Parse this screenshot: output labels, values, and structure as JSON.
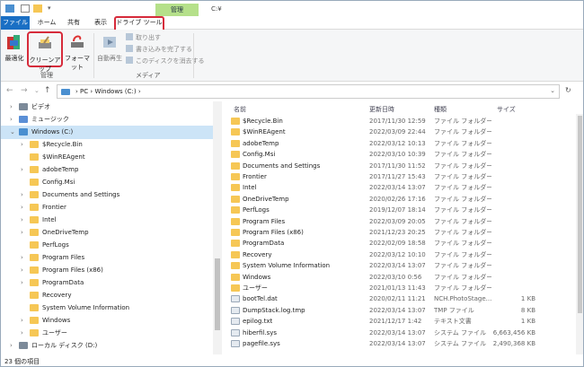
{
  "titlebar": {
    "context_tab": "管理",
    "path_title": "C:¥"
  },
  "ribbon_tabs": {
    "file": "ファイル",
    "home": "ホーム",
    "share": "共有",
    "view": "表示",
    "drive_tools": "ドライブ ツール"
  },
  "ribbon": {
    "optimize": "最適化",
    "cleanup": "クリーンアップ",
    "format": "フォーマット",
    "group_manage": "管理",
    "autoplay": "自動再生",
    "eject": "取り出す",
    "finish_burn": "書き込みを完了する",
    "erase_disc": "このディスクを消去する",
    "group_media": "メディア"
  },
  "nav": {
    "back": "←",
    "forward": "→",
    "recent": "⌄",
    "up": "↑",
    "crumb_sep": "›",
    "pc": "PC",
    "drive": "Windows (C:)",
    "dropdown": "⌄",
    "refresh": "↻"
  },
  "tree": [
    {
      "label": "ビデオ",
      "icon": "video",
      "indent": 0,
      "chev": "›"
    },
    {
      "label": "ミュージック",
      "icon": "music",
      "indent": 0,
      "chev": "›"
    },
    {
      "label": "Windows (C:)",
      "icon": "pc",
      "indent": 0,
      "chev": "⌄",
      "selected": true
    },
    {
      "label": "$Recycle.Bin",
      "icon": "folder",
      "indent": 1,
      "chev": "›"
    },
    {
      "label": "$WinREAgent",
      "icon": "folder",
      "indent": 1,
      "chev": ""
    },
    {
      "label": "adobeTemp",
      "icon": "folder",
      "indent": 1,
      "chev": "›"
    },
    {
      "label": "Config.Msi",
      "icon": "folder",
      "indent": 1,
      "chev": ""
    },
    {
      "label": "Documents and Settings",
      "icon": "folder",
      "indent": 1,
      "chev": "›"
    },
    {
      "label": "Frontier",
      "icon": "folder",
      "indent": 1,
      "chev": "›"
    },
    {
      "label": "Intel",
      "icon": "folder",
      "indent": 1,
      "chev": "›"
    },
    {
      "label": "OneDriveTemp",
      "icon": "folder",
      "indent": 1,
      "chev": "›"
    },
    {
      "label": "PerfLogs",
      "icon": "folder",
      "indent": 1,
      "chev": ""
    },
    {
      "label": "Program Files",
      "icon": "folder",
      "indent": 1,
      "chev": "›"
    },
    {
      "label": "Program Files (x86)",
      "icon": "folder",
      "indent": 1,
      "chev": "›"
    },
    {
      "label": "ProgramData",
      "icon": "folder",
      "indent": 1,
      "chev": "›"
    },
    {
      "label": "Recovery",
      "icon": "folder",
      "indent": 1,
      "chev": ""
    },
    {
      "label": "System Volume Information",
      "icon": "folder",
      "indent": 1,
      "chev": ""
    },
    {
      "label": "Windows",
      "icon": "folder",
      "indent": 1,
      "chev": "›"
    },
    {
      "label": "ユーザー",
      "icon": "folder",
      "indent": 1,
      "chev": "›"
    },
    {
      "label": "ローカル ディスク (D:)",
      "icon": "drive",
      "indent": 0,
      "chev": "›"
    }
  ],
  "list_headers": {
    "name": "名前",
    "date": "更新日時",
    "type": "種類",
    "size": "サイズ"
  },
  "files": [
    {
      "name": "$Recycle.Bin",
      "date": "2017/11/30 12:59",
      "type": "ファイル フォルダー",
      "size": "",
      "icon": "folder"
    },
    {
      "name": "$WinREAgent",
      "date": "2022/03/09 22:44",
      "type": "ファイル フォルダー",
      "size": "",
      "icon": "folder"
    },
    {
      "name": "adobeTemp",
      "date": "2022/03/12 10:13",
      "type": "ファイル フォルダー",
      "size": "",
      "icon": "folder"
    },
    {
      "name": "Config.Msi",
      "date": "2022/03/10 10:39",
      "type": "ファイル フォルダー",
      "size": "",
      "icon": "folder"
    },
    {
      "name": "Documents and Settings",
      "date": "2017/11/30 11:52",
      "type": "ファイル フォルダー",
      "size": "",
      "icon": "folder"
    },
    {
      "name": "Frontier",
      "date": "2017/11/27 15:43",
      "type": "ファイル フォルダー",
      "size": "",
      "icon": "folder"
    },
    {
      "name": "Intel",
      "date": "2022/03/14 13:07",
      "type": "ファイル フォルダー",
      "size": "",
      "icon": "folder"
    },
    {
      "name": "OneDriveTemp",
      "date": "2020/02/26 17:16",
      "type": "ファイル フォルダー",
      "size": "",
      "icon": "folder"
    },
    {
      "name": "PerfLogs",
      "date": "2019/12/07 18:14",
      "type": "ファイル フォルダー",
      "size": "",
      "icon": "folder"
    },
    {
      "name": "Program Files",
      "date": "2022/03/09 20:05",
      "type": "ファイル フォルダー",
      "size": "",
      "icon": "folder"
    },
    {
      "name": "Program Files (x86)",
      "date": "2021/12/23 20:25",
      "type": "ファイル フォルダー",
      "size": "",
      "icon": "folder"
    },
    {
      "name": "ProgramData",
      "date": "2022/02/09 18:58",
      "type": "ファイル フォルダー",
      "size": "",
      "icon": "folder"
    },
    {
      "name": "Recovery",
      "date": "2022/03/12 10:10",
      "type": "ファイル フォルダー",
      "size": "",
      "icon": "folder"
    },
    {
      "name": "System Volume Information",
      "date": "2022/03/14 13:07",
      "type": "ファイル フォルダー",
      "size": "",
      "icon": "folder"
    },
    {
      "name": "Windows",
      "date": "2022/03/10 0:56",
      "type": "ファイル フォルダー",
      "size": "",
      "icon": "folder"
    },
    {
      "name": "ユーザー",
      "date": "2021/01/13 11:43",
      "type": "ファイル フォルダー",
      "size": "",
      "icon": "folder"
    },
    {
      "name": "bootTel.dat",
      "date": "2020/02/11 11:21",
      "type": "NCH.PhotoStage....",
      "size": "1 KB",
      "icon": "file"
    },
    {
      "name": "DumpStack.log.tmp",
      "date": "2022/03/14 13:07",
      "type": "TMP ファイル",
      "size": "8 KB",
      "icon": "file"
    },
    {
      "name": "epilog.txt",
      "date": "2021/12/17 1:42",
      "type": "テキスト文書",
      "size": "1 KB",
      "icon": "file"
    },
    {
      "name": "hiberfil.sys",
      "date": "2022/03/14 13:07",
      "type": "システム ファイル",
      "size": "6,663,456 KB",
      "icon": "file"
    },
    {
      "name": "pagefile.sys",
      "date": "2022/03/14 13:07",
      "type": "システム ファイル",
      "size": "2,490,368 KB",
      "icon": "file"
    }
  ],
  "status": {
    "count_text": "23 個の項目"
  }
}
